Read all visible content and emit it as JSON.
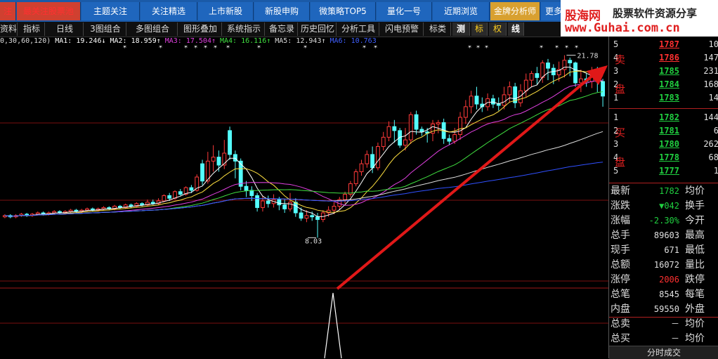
{
  "top_tabs": [
    {
      "label": "注",
      "style": "red"
    },
    {
      "label": "最关注股票池",
      "style": "red"
    },
    {
      "label": "主题关注",
      "style": "blue"
    },
    {
      "label": "关注精选",
      "style": "blue"
    },
    {
      "label": "上市新股",
      "style": "blue"
    },
    {
      "label": "新股申购",
      "style": "blue"
    },
    {
      "label": "微策略TOP5",
      "style": "blue"
    },
    {
      "label": "量化一号",
      "style": "blue"
    },
    {
      "label": "近期浏览",
      "style": "blue"
    },
    {
      "label": "金牌分析师",
      "style": "gold"
    },
    {
      "label": "更多",
      "style": "blue"
    }
  ],
  "logo": {
    "name": "股海网",
    "slogan": "股票软件资源分享",
    "url": "www.Guhai.com.cn"
  },
  "toolbar": [
    "资料",
    "指标",
    "日线",
    "3图组合",
    "多图组合",
    "图形叠加",
    "系统指示",
    "备忘录",
    "历史回忆",
    "分析工具",
    "闪电预警",
    "标类",
    "测",
    "标",
    "权",
    "线"
  ],
  "ma_line": [
    {
      "text": "0,30,60,120)",
      "color": "#dddddd"
    },
    {
      "text": "MA1: 19.246↓",
      "color": "#ffffff"
    },
    {
      "text": "MA2: 18.959↑",
      "color": "#ffffff"
    },
    {
      "text": "MA3: 17.504↑",
      "color": "#e040e0"
    },
    {
      "text": "MA4: 16.116↑",
      "color": "#40e040"
    },
    {
      "text": "MA5: 12.943↑",
      "color": "#dddddd"
    },
    {
      "text": "MA6: 10.763",
      "color": "#4060ff"
    }
  ],
  "chart_labels": {
    "high": "21.78",
    "low": "8.03"
  },
  "chart_data": {
    "type": "candlestick",
    "ylim": [
      4.5,
      22.5
    ],
    "candles": [
      [
        9.6,
        9.7,
        9.5,
        9.8
      ],
      [
        9.7,
        9.6,
        9.5,
        9.8
      ],
      [
        9.6,
        9.7,
        9.5,
        9.8
      ],
      [
        9.7,
        9.8,
        9.6,
        9.9
      ],
      [
        9.8,
        9.7,
        9.6,
        9.9
      ],
      [
        9.7,
        9.8,
        9.6,
        9.9
      ],
      [
        9.8,
        9.9,
        9.7,
        10.0
      ],
      [
        9.9,
        9.8,
        9.7,
        10.0
      ],
      [
        9.8,
        9.9,
        9.7,
        10.0
      ],
      [
        9.9,
        10.0,
        9.8,
        10.1
      ],
      [
        10.0,
        9.9,
        9.8,
        10.1
      ],
      [
        9.9,
        10.0,
        9.8,
        10.1
      ],
      [
        10.0,
        10.1,
        9.9,
        10.2
      ],
      [
        10.1,
        10.0,
        9.9,
        10.2
      ],
      [
        10.0,
        10.1,
        9.9,
        10.2
      ],
      [
        10.1,
        10.2,
        10.0,
        10.3
      ],
      [
        10.2,
        10.1,
        10.0,
        10.3
      ],
      [
        10.1,
        10.2,
        10.0,
        10.3
      ],
      [
        10.2,
        10.3,
        10.1,
        10.4
      ],
      [
        10.3,
        10.2,
        10.1,
        10.4
      ],
      [
        10.2,
        10.4,
        10.1,
        10.5
      ],
      [
        10.4,
        10.3,
        10.2,
        10.5
      ],
      [
        10.3,
        10.5,
        10.2,
        10.6
      ],
      [
        10.5,
        10.4,
        10.3,
        10.6
      ],
      [
        10.4,
        10.6,
        10.3,
        10.7
      ],
      [
        10.6,
        10.5,
        10.4,
        10.7
      ],
      [
        10.5,
        10.7,
        10.4,
        10.9
      ],
      [
        10.7,
        10.6,
        10.5,
        10.9
      ],
      [
        10.6,
        10.8,
        10.5,
        11.0
      ],
      [
        10.8,
        11.2,
        10.7,
        11.3
      ],
      [
        11.2,
        11.0,
        10.8,
        11.4
      ],
      [
        11.0,
        11.5,
        10.9,
        11.6
      ],
      [
        11.5,
        11.3,
        11.2,
        11.7
      ],
      [
        11.3,
        11.8,
        11.2,
        11.9
      ],
      [
        11.8,
        11.6,
        11.4,
        12.0
      ],
      [
        11.6,
        12.6,
        11.5,
        12.8
      ],
      [
        13.6,
        12.3,
        12.0,
        13.9
      ],
      [
        12.3,
        13.8,
        12.1,
        14.5
      ],
      [
        13.8,
        14.1,
        13.0,
        15.0
      ],
      [
        14.1,
        13.5,
        13.0,
        14.6
      ],
      [
        13.5,
        14.4,
        13.2,
        15.4
      ],
      [
        16.1,
        14.3,
        13.9,
        16.4
      ],
      [
        14.3,
        13.8,
        12.5,
        14.6
      ],
      [
        13.8,
        11.9,
        11.6,
        14.0
      ],
      [
        11.9,
        11.6,
        11.1,
        12.3
      ],
      [
        11.6,
        11.2,
        10.8,
        11.9
      ],
      [
        11.2,
        10.3,
        10.0,
        11.4
      ],
      [
        10.3,
        10.8,
        10.0,
        11.2
      ],
      [
        10.8,
        10.6,
        10.3,
        11.2
      ],
      [
        10.6,
        10.9,
        10.3,
        11.3
      ],
      [
        10.9,
        10.5,
        10.1,
        11.1
      ],
      [
        10.5,
        10.2,
        9.9,
        10.9
      ],
      [
        10.2,
        10.7,
        10.0,
        11.4
      ],
      [
        10.7,
        9.9,
        9.6,
        11.0
      ],
      [
        9.9,
        9.5,
        9.3,
        10.3
      ],
      [
        9.5,
        9.7,
        9.2,
        10.1
      ],
      [
        9.7,
        9.6,
        9.3,
        10.0
      ],
      [
        9.6,
        9.4,
        8.03,
        9.9
      ],
      [
        9.4,
        9.9,
        9.2,
        10.1
      ],
      [
        9.9,
        10.1,
        9.6,
        10.4
      ],
      [
        10.1,
        10.4,
        9.8,
        10.7
      ],
      [
        10.4,
        10.9,
        10.1,
        11.1
      ],
      [
        10.9,
        11.3,
        10.6,
        11.5
      ],
      [
        11.3,
        12.1,
        11.1,
        12.3
      ],
      [
        12.1,
        13.0,
        11.9,
        13.2
      ],
      [
        13.0,
        13.6,
        12.7,
        13.9
      ],
      [
        13.6,
        14.3,
        13.3,
        14.6
      ],
      [
        14.3,
        13.3,
        12.9,
        14.9
      ],
      [
        13.3,
        14.9,
        13.1,
        15.2
      ],
      [
        14.9,
        15.6,
        14.6,
        16.0
      ],
      [
        15.6,
        16.4,
        15.3,
        16.8
      ],
      [
        16.4,
        16.1,
        15.2,
        16.9
      ],
      [
        16.1,
        15.0,
        14.8,
        16.3
      ],
      [
        15.0,
        15.4,
        14.6,
        16.3
      ],
      [
        15.4,
        17.3,
        15.1,
        17.5
      ],
      [
        17.3,
        16.2,
        15.8,
        17.6
      ],
      [
        16.2,
        16.0,
        15.7,
        16.4
      ],
      [
        16.0,
        15.9,
        15.2,
        16.3
      ],
      [
        15.9,
        16.6,
        15.3,
        16.9
      ],
      [
        16.6,
        16.7,
        15.9,
        16.9
      ],
      [
        16.7,
        15.5,
        15.1,
        17.0
      ],
      [
        15.5,
        15.3,
        15.0,
        15.8
      ],
      [
        15.3,
        15.8,
        15.1,
        16.3
      ],
      [
        15.8,
        17.1,
        15.4,
        17.5
      ],
      [
        17.1,
        17.9,
        16.6,
        18.4
      ],
      [
        17.9,
        18.7,
        17.4,
        19.1
      ],
      [
        18.7,
        18.1,
        17.7,
        19.4
      ],
      [
        18.1,
        17.9,
        17.5,
        18.6
      ],
      [
        17.9,
        18.5,
        17.6,
        18.9
      ],
      [
        18.5,
        18.1,
        17.8,
        18.8
      ],
      [
        18.1,
        18.0,
        17.6,
        18.6
      ],
      [
        18.0,
        18.8,
        17.7,
        19.4
      ],
      [
        18.8,
        19.4,
        18.2,
        19.8
      ],
      [
        19.4,
        18.2,
        17.8,
        19.7
      ],
      [
        18.2,
        19.1,
        17.9,
        19.6
      ],
      [
        19.1,
        19.9,
        18.6,
        20.4
      ],
      [
        19.9,
        20.4,
        19.4,
        20.6
      ],
      [
        20.4,
        20.1,
        19.6,
        20.9
      ],
      [
        20.1,
        21.2,
        19.7,
        21.4
      ],
      [
        21.2,
        20.8,
        19.9,
        21.5
      ],
      [
        20.8,
        20.3,
        19.6,
        21.1
      ],
      [
        20.3,
        20.7,
        19.8,
        21.3
      ],
      [
        20.7,
        21.4,
        20.1,
        21.78
      ],
      [
        21.4,
        21.2,
        20.2,
        21.6
      ],
      [
        21.2,
        19.7,
        19.4,
        21.3
      ],
      [
        19.7,
        20.0,
        19.0,
        20.7
      ],
      [
        20.0,
        19.8,
        19.4,
        20.4
      ],
      [
        19.8,
        20.5,
        19.3,
        20.9
      ],
      [
        20.5,
        19.8,
        19.0,
        20.9
      ],
      [
        19.8,
        18.7,
        17.9,
        20.0
      ]
    ]
  },
  "orderbook": {
    "sell_label": [
      "卖",
      "盘"
    ],
    "buy_label": [
      "买",
      "盘"
    ],
    "sell": [
      {
        "level": "5",
        "price": "1787",
        "vol": "10"
      },
      {
        "level": "4",
        "price": "1786",
        "vol": "147"
      },
      {
        "level": "3",
        "price": "1785",
        "vol": "231"
      },
      {
        "level": "2",
        "price": "1784",
        "vol": "168"
      },
      {
        "level": "1",
        "price": "1783",
        "vol": "14"
      }
    ],
    "buy": [
      {
        "level": "1",
        "price": "1782",
        "vol": "144"
      },
      {
        "level": "2",
        "price": "1781",
        "vol": "6"
      },
      {
        "level": "3",
        "price": "1780",
        "vol": "262"
      },
      {
        "level": "4",
        "price": "1778",
        "vol": "68"
      },
      {
        "level": "5",
        "price": "1777",
        "vol": "1"
      }
    ]
  },
  "quotes": [
    {
      "k": "最新",
      "v": "1782",
      "vc": "green",
      "k2": "均价"
    },
    {
      "k": "涨跌",
      "v": "▼042",
      "vc": "green",
      "k2": "换手"
    },
    {
      "k": "涨幅",
      "v": "-2.30%",
      "vc": "green",
      "k2": "今开"
    },
    {
      "k": "总手",
      "v": "89603",
      "vc": "white",
      "k2": "最高"
    },
    {
      "k": "现手",
      "v": "671",
      "vc": "white",
      "k2": "最低"
    },
    {
      "k": "总额",
      "v": "16072",
      "vc": "white",
      "k2": "量比"
    },
    {
      "k": "涨停",
      "v": "2006",
      "vc": "red",
      "k2": "跌停"
    },
    {
      "k": "总笔",
      "v": "8545",
      "vc": "white",
      "k2": "每笔"
    },
    {
      "k": "内盘",
      "v": "59550",
      "vc": "white",
      "k2": "外盘"
    },
    {
      "k": "总卖",
      "v": "－",
      "vc": "white",
      "k2": "均价"
    },
    {
      "k": "总买",
      "v": "－",
      "vc": "white",
      "k2": "均价"
    }
  ],
  "footer": "分时成交"
}
